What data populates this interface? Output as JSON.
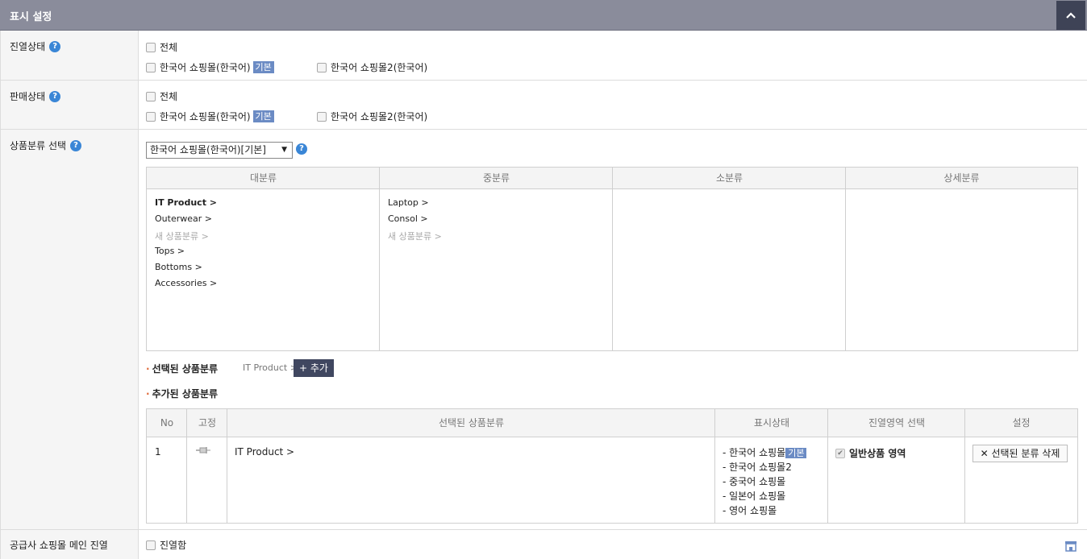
{
  "header": {
    "title": "표시 설정",
    "collapse_icon": "chevron-up-icon"
  },
  "display_status": {
    "label": "진열상태",
    "all_label": "전체",
    "mall1": "한국어 쇼핑몰(한국어)",
    "mall1_tag": "기본",
    "mall2": "한국어 쇼핑몰2(한국어)"
  },
  "sale_status": {
    "label": "판매상태",
    "all_label": "전체",
    "mall1": "한국어 쇼핑몰(한국어)",
    "mall1_tag": "기본",
    "mall2": "한국어 쇼핑몰2(한국어)"
  },
  "category": {
    "label": "상품분류 선택",
    "select_value": "한국어 쇼핑몰(한국어)[기본]",
    "columns": [
      "대분류",
      "중분류",
      "소분류",
      "상세분류"
    ],
    "large": [
      "IT Product >",
      "Outerwear >",
      "새 상품분류 >",
      "Tops >",
      "Bottoms >",
      "Accessories >"
    ],
    "medium": [
      "Laptop >",
      "Consol >",
      "새 상품분류 >"
    ]
  },
  "selected": {
    "label": "선택된 상품분류",
    "value": "IT Product >",
    "add_label": "+ 추가"
  },
  "added": {
    "label": "추가된 상품분류",
    "headers": [
      "No",
      "고정",
      "선택된 상품분류",
      "표시상태",
      "진열영역 선택",
      "설정"
    ],
    "row": {
      "no": "1",
      "category": "IT Product >",
      "status": [
        "- 한국어 쇼핑몰",
        "- 한국어 쇼핑몰2",
        "- 중국어 쇼핑몰",
        "- 일본어 쇼핑몰",
        "- 영어 쇼핑몰"
      ],
      "status_tag": "기본",
      "area": "일반상품 영역",
      "delete_label": "✕ 선택된 분류 삭제"
    }
  },
  "supplier": {
    "label": "공급사 쇼핑몰 메인 진열",
    "check_label": "진열함"
  },
  "colors": {
    "header_bg": "#8a8c9b",
    "toggle_bg": "#3e4356",
    "help": "#3a86d6",
    "tag": "#6b8bc4"
  }
}
